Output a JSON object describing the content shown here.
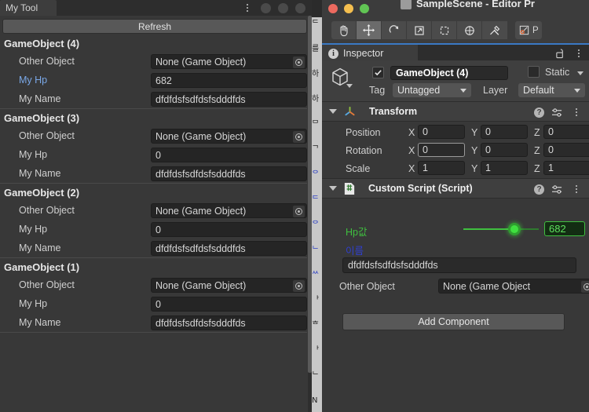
{
  "left_window": {
    "tab_label": "My Tool",
    "menu_icon": "kebab-menu-icon",
    "refresh_button": "Refresh",
    "groups": [
      {
        "title": "GameObject (4)",
        "rows": [
          {
            "label": "Other Object",
            "value": "None (Game Object)",
            "type": "object",
            "highlight": false
          },
          {
            "label": "My Hp",
            "value": "682",
            "type": "text",
            "highlight": true
          },
          {
            "label": "My Name",
            "value": "dfdfdsfsdfdsfsdddfds",
            "type": "text",
            "highlight": false
          }
        ]
      },
      {
        "title": "GameObject (3)",
        "rows": [
          {
            "label": "Other Object",
            "value": "None (Game Object)",
            "type": "object",
            "highlight": false
          },
          {
            "label": "My Hp",
            "value": "0",
            "type": "text",
            "highlight": false
          },
          {
            "label": "My Name",
            "value": "dfdfdsfsdfdsfsdddfds",
            "type": "text",
            "highlight": false
          }
        ]
      },
      {
        "title": "GameObject (2)",
        "rows": [
          {
            "label": "Other Object",
            "value": "None (Game Object)",
            "type": "object",
            "highlight": false
          },
          {
            "label": "My Hp",
            "value": "0",
            "type": "text",
            "highlight": false
          },
          {
            "label": "My Name",
            "value": "dfdfdsfsdfdsfsdddfds",
            "type": "text",
            "highlight": false
          }
        ]
      },
      {
        "title": "GameObject (1)",
        "rows": [
          {
            "label": "Other Object",
            "value": "None (Game Object)",
            "type": "object",
            "highlight": false
          },
          {
            "label": "My Hp",
            "value": "0",
            "type": "text",
            "highlight": false
          },
          {
            "label": "My Name",
            "value": "dfdfdsfsdfdsfsdddfds",
            "type": "text",
            "highlight": false
          }
        ]
      }
    ]
  },
  "background_window": {
    "lines": [
      "ᄃ",
      "를",
      "하",
      "하",
      "ᄆ",
      "ᄀ",
      "ᄋ",
      "ᄃ",
      "ᄋ",
      "ᄂ",
      "ᄊ",
      "ᅡ",
      "ᄒ",
      "ᅡ",
      "ᄂ",
      "N"
    ]
  },
  "unity_window": {
    "title": "SampleScene - Editor Pr",
    "traffic_lights": [
      "#ed6a5f",
      "#f5bf4f",
      "#61c554"
    ],
    "toolbar": [
      {
        "name": "hand-tool",
        "selected": false
      },
      {
        "name": "move-tool",
        "selected": true
      },
      {
        "name": "rotate-tool",
        "selected": false
      },
      {
        "name": "scale-tool",
        "selected": false
      },
      {
        "name": "rect-tool",
        "selected": false
      },
      {
        "name": "transform-tool",
        "selected": false
      },
      {
        "name": "custom-tool",
        "selected": false
      }
    ],
    "pivot_button_label": "P",
    "inspector": {
      "tab_label": "Inspector",
      "tab_icon": "info-icon",
      "lock_icon": "lock-open-icon",
      "menu_icon": "kebab-menu-icon",
      "game_object": {
        "enabled": true,
        "name": "GameObject (4)",
        "static_label": "Static",
        "static_checked": false,
        "tag_label": "Tag",
        "tag_value": "Untagged",
        "layer_label": "Layer",
        "layer_value": "Default"
      },
      "transform": {
        "title": "Transform",
        "rows": [
          {
            "name": "Position",
            "x": "0",
            "y": "0",
            "z": "0",
            "focus": ""
          },
          {
            "name": "Rotation",
            "x": "0",
            "y": "0",
            "z": "0",
            "focus": "x"
          },
          {
            "name": "Scale",
            "x": "1",
            "y": "1",
            "z": "1",
            "focus": ""
          }
        ],
        "axis_labels": [
          "X",
          "Y",
          "Z"
        ]
      },
      "custom_script": {
        "title": "Custom Script (Script)",
        "hp_label": "Hp값",
        "hp_value": "682",
        "slider_percent": 68,
        "name_label": "이름",
        "name_value": "dfdfdsfsdfdsfsdddfds",
        "other_object_label": "Other Object",
        "other_object_value": "None (Game Object"
      },
      "add_component_button": "Add Component"
    }
  },
  "colors": {
    "panel_bg": "#383838",
    "header_bg": "#3f3f3f",
    "field_bg": "#2a2a2a",
    "accent_blue": "#3a79c4",
    "script_green": "#3fbf3f",
    "script_blue": "#2f3fd0",
    "label_blue": "#7aa8e8"
  }
}
